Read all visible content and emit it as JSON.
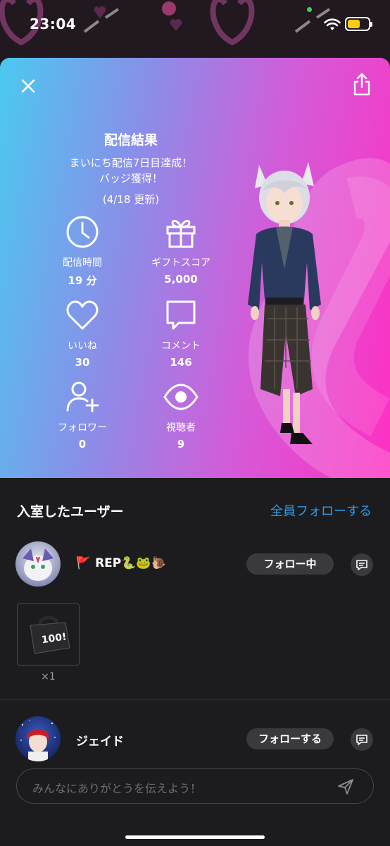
{
  "status_bar": {
    "time": "23:04",
    "battery_level": 0.6
  },
  "result": {
    "title": "配信結果",
    "subtitle_line1": "まいにち配信7日目達成！",
    "subtitle_line2": "バッジ獲得！",
    "updated": "(4/18 更新)",
    "stats": {
      "duration": {
        "icon": "clock-icon",
        "label": "配信時間",
        "value": "19 分"
      },
      "gift_score": {
        "icon": "gift-icon",
        "label": "ギフトスコア",
        "value": "5,000"
      },
      "likes": {
        "icon": "heart-icon",
        "label": "いいね",
        "value": "30"
      },
      "comments": {
        "icon": "comment-icon",
        "label": "コメント",
        "value": "146"
      },
      "followers": {
        "icon": "add-user-icon",
        "label": "フォロワー",
        "value": "0"
      },
      "viewers": {
        "icon": "eye-icon",
        "label": "視聴者",
        "value": "9"
      }
    }
  },
  "visitors": {
    "title": "入室したユーザー",
    "follow_all": "全員フォローする",
    "users": [
      {
        "name": "🚩 REP🐍🐸🐌",
        "follow_label": "フォロー中",
        "gift_count": "×1",
        "gift_badge": "100!"
      },
      {
        "name": "ジェイド",
        "follow_label": "フォローする"
      }
    ]
  },
  "message": {
    "placeholder": "みんなにありがとうを伝えよう！"
  },
  "colors": {
    "accent": "#2d9bf0",
    "gradient_start": "#4bc9f0",
    "gradient_end": "#ff2fc2",
    "background": "#1c1c1e"
  }
}
